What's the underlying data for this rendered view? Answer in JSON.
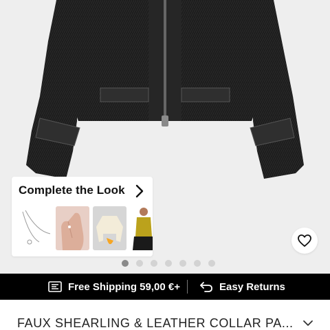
{
  "complete_look": {
    "title": "Complete the Look",
    "items": [
      {
        "icon": "necklace-icon"
      },
      {
        "icon": "ring-icon"
      },
      {
        "icon": "sweater-icon"
      },
      {
        "icon": "top-icon"
      }
    ]
  },
  "gallery": {
    "photo": "black-faux-shearling-jacket",
    "slide_count": 7,
    "active_slide": 1
  },
  "wishlist": {
    "icon": "heart-icon"
  },
  "promo_bar": {
    "shipping_label": "Free Shipping 59,00 €+",
    "shipping_icon": "shipping-list-icon",
    "returns_label": "Easy Returns",
    "returns_icon": "return-arrow-icon"
  },
  "product": {
    "title": "FAUX SHEARLING & LEATHER COLLAR PA..."
  },
  "colors": {
    "promo_bg": "#000000",
    "gallery_bg": "#eeeeee",
    "dot_active": "#8a8a8a",
    "dot_inactive": "#d3d3d3"
  }
}
